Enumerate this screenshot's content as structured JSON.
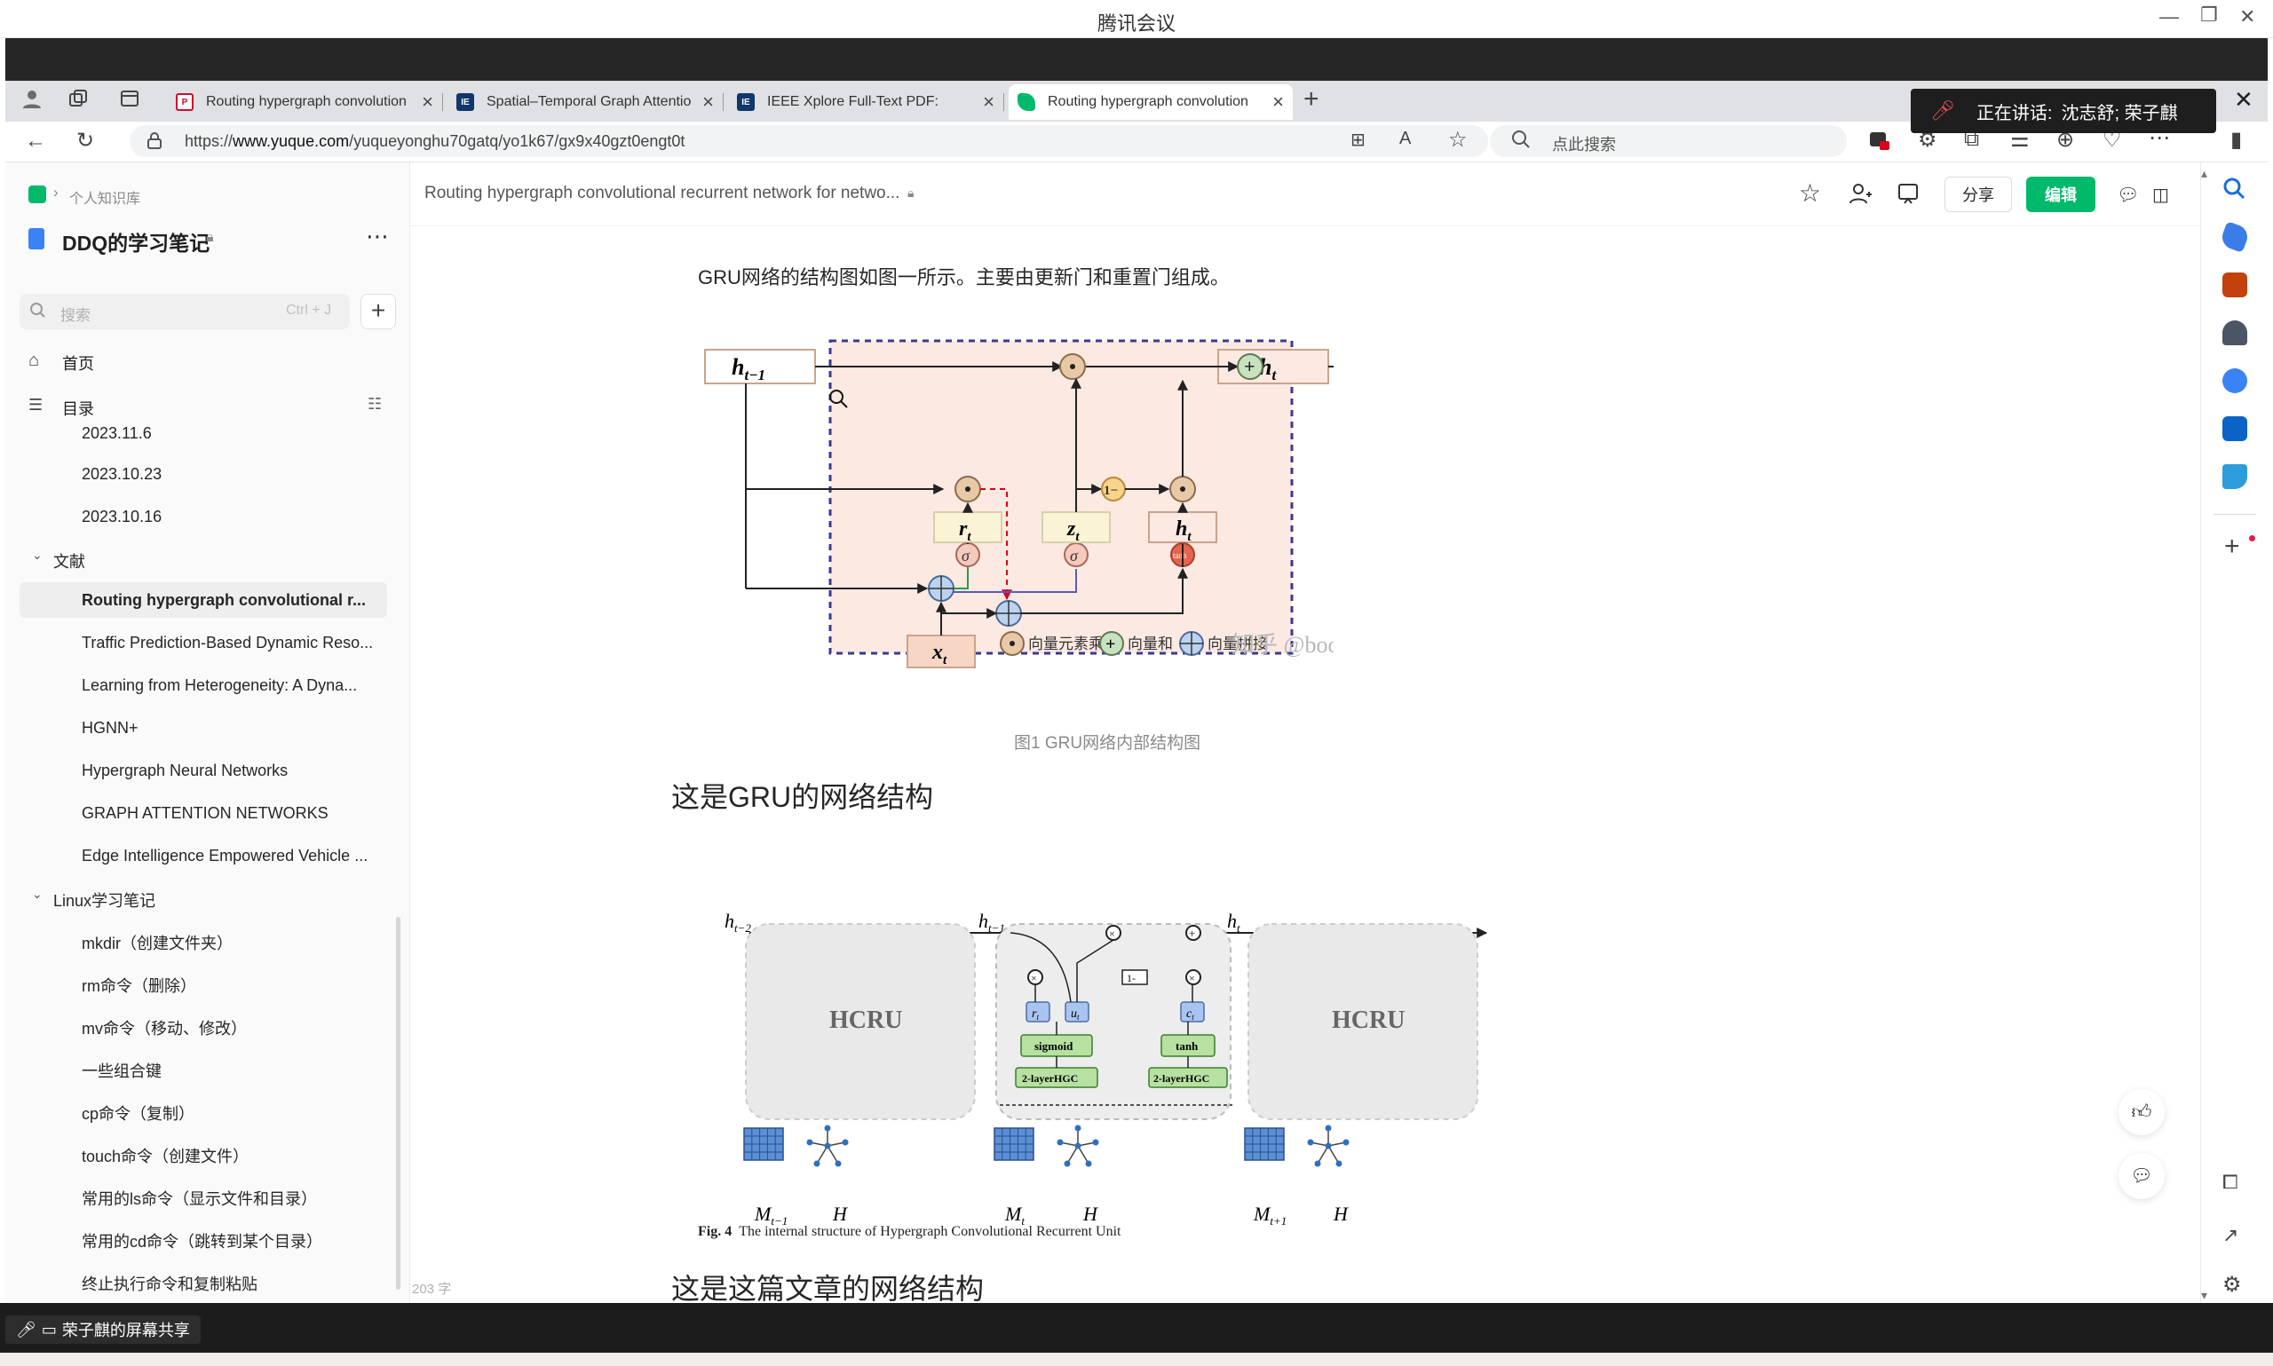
{
  "meeting": {
    "app_title": "腾讯会议",
    "speaking_label": "正在讲话:",
    "speaking_names": "沈志舒; 荣子麒",
    "share_label": "荣子麒的屏幕共享"
  },
  "browser": {
    "tabs": [
      {
        "label": "Routing hypergraph convolution",
        "favicon": "pdf-icon",
        "active": false
      },
      {
        "label": "Spatial–Temporal Graph Attentio",
        "favicon": "ieee-icon",
        "active": false
      },
      {
        "label": "IEEE Xplore Full-Text PDF:",
        "favicon": "ieee-icon",
        "active": false
      },
      {
        "label": "Routing hypergraph convolution",
        "favicon": "yuque-icon",
        "active": true
      }
    ],
    "url_prefix": "https://",
    "url_host": "www.yuque.com",
    "url_path": "/yuqueyonghu70gatq/yo1k67/gx9x40gzt0engt0t",
    "search_placeholder": "点此搜索"
  },
  "sidebar": {
    "breadcrumb": "个人知识库",
    "book_title": "DDQ的学习笔记",
    "search_placeholder": "搜索",
    "search_shortcut": "Ctrl + J",
    "home_label": "首页",
    "toc_label": "目录",
    "items_top": [
      "2023.11.6",
      "2023.10.23",
      "2023.10.16"
    ],
    "section_papers": "文献",
    "papers": [
      "Routing hypergraph convolutional r...",
      "Traffic Prediction-Based Dynamic Reso...",
      "Learning from Heterogeneity: A Dyna...",
      "HGNN+",
      "Hypergraph Neural Networks",
      "GRAPH ATTENTION NETWORKS",
      "Edge Intelligence Empowered Vehicle ..."
    ],
    "section_linux": "Linux学习笔记",
    "linux_items": [
      "mkdir（创建文件夹）",
      "rm命令（删除）",
      "mv命令（移动、修改）",
      "一些组合键",
      "cp命令（复制）",
      "touch命令（创建文件）",
      "常用的ls命令（显示文件和目录）",
      "常用的cd命令（跳转到某个目录）",
      "终止执行命令和复制粘贴"
    ],
    "word_count": "203 字"
  },
  "doc": {
    "path_title": "Routing hypergraph convolutional recurrent network for netwo...",
    "share_button": "分享",
    "edit_button": "编辑",
    "para1": "GRU网络的结构图如图一所示。主要由更新门和重置门组成。",
    "fig1_caption": "图1 GRU网络内部结构图",
    "heading1": "这是GRU的网络结构",
    "heading2": "这是这篇文章的网络结构",
    "fig1": {
      "h_prev": "h",
      "h_prev_sub": "t−1",
      "h_t": "h",
      "h_t_sub": "t",
      "r_t": "r",
      "z_t": "z",
      "hh_t": "h",
      "x_t": "x",
      "sub_t": "t",
      "sigma": "σ",
      "tanh": "tanh",
      "one_minus": "1−",
      "legend_mul": "向量元素乘",
      "legend_add": "向量和",
      "legend_concat": "向量拼接",
      "watermark": "知乎 @boom"
    },
    "fig2": {
      "cell_label": "HCRU",
      "sigmoid": "sigmoid",
      "tanh": "tanh",
      "hgc": "2-layerHGC",
      "one_minus": "1-",
      "r": "r",
      "u": "u",
      "c": "c",
      "h": "h",
      "H": "H",
      "M": "M",
      "sub_t2": "t−2",
      "sub_t1": "t−1",
      "sub_t": "t",
      "sub_tp1": "t+1",
      "fig_no": "Fig. 4",
      "fig_caption": "The internal structure of Hypergraph Convolutional Recurrent Unit"
    }
  },
  "colors": {
    "accent_green": "#00b96b",
    "gru_bg": "#fbe9e2",
    "gru_border": "#3a3a8f",
    "hgc_green": "#b7e1a1",
    "gate_blue": "#a9c4ef"
  }
}
